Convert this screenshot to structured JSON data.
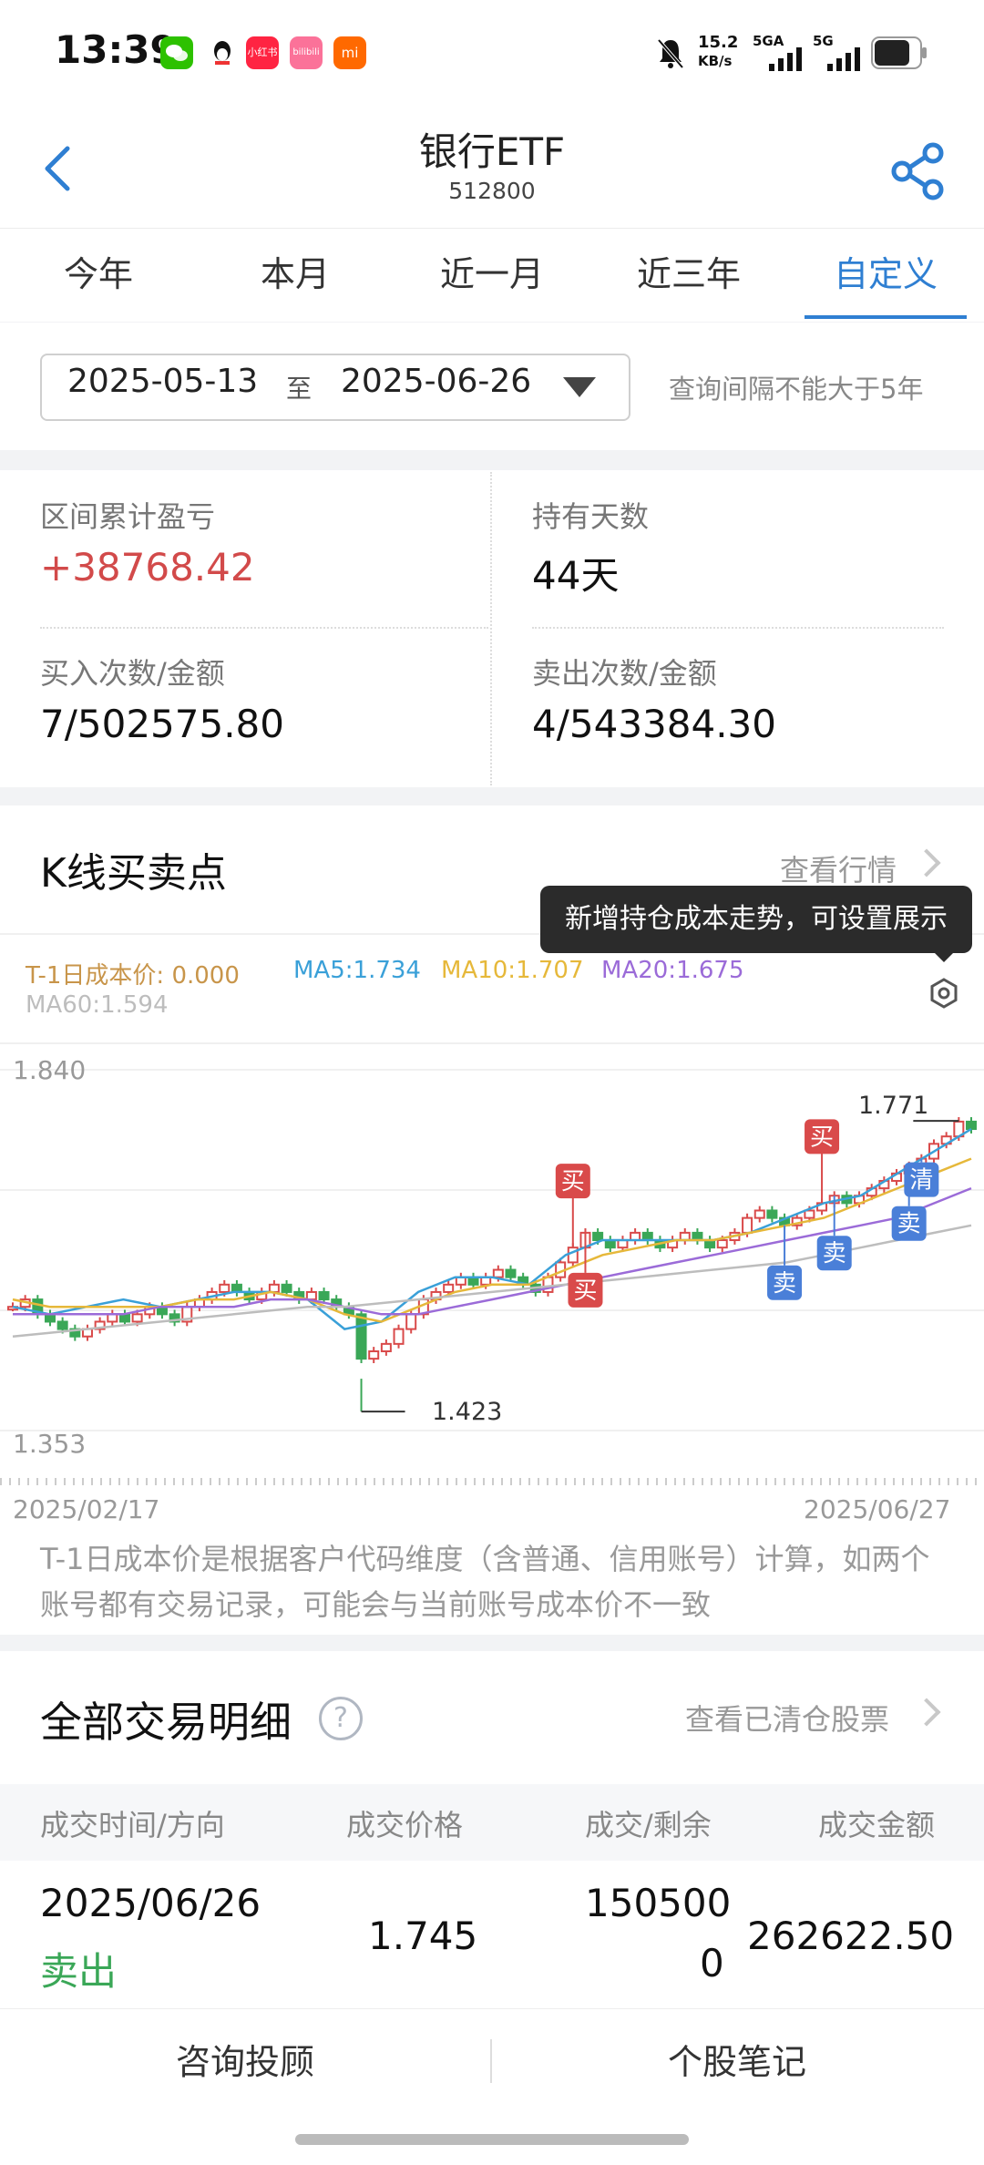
{
  "status_bar": {
    "time": "13:39",
    "apps": [
      {
        "name": "wechat-icon",
        "color": "#2dc100",
        "text": ""
      },
      {
        "name": "qq-icon",
        "color": "#ffffff",
        "text": ""
      },
      {
        "name": "xiaohongshu-icon",
        "color": "#ff2442",
        "text": "小红书"
      },
      {
        "name": "bilibili-icon",
        "color": "#fb7299",
        "text": "bilibili"
      },
      {
        "name": "mi-icon",
        "color": "#ff6900",
        "text": "mi"
      }
    ],
    "net_speed": "15.2",
    "net_unit": "KB/s",
    "sim1": "5GA",
    "sim2": "5G"
  },
  "header": {
    "title": "银行ETF",
    "code": "512800"
  },
  "tabs": [
    "今年",
    "本月",
    "近一月",
    "近三年",
    "自定义"
  ],
  "active_tab": 4,
  "date_range": {
    "start": "2025-05-13",
    "to": "至",
    "end": "2025-06-26",
    "note": "查询间隔不能大于5年"
  },
  "summary": {
    "pnl_label": "区间累计盈亏",
    "pnl_value": "+38768.42",
    "days_label": "持有天数",
    "days_value": "44天",
    "buy_label": "买入次数/金额",
    "buy_value": "7/502575.80",
    "sell_label": "卖出次数/金额",
    "sell_value": "4/543384.30"
  },
  "kline": {
    "title": "K线买卖点",
    "link": "查看行情",
    "tooltip": "新增持仓成本走势，可设置展示",
    "legend": {
      "cost": "T-1日成本价: 0.000",
      "ma5": "MA5:1.734",
      "ma10": "MA10:1.707",
      "ma20": "MA20:1.675",
      "ma60": "MA60:1.594"
    },
    "colors": {
      "cost": "#c8954a",
      "ma5": "#3aa0d8",
      "ma10": "#e6b83a",
      "ma20": "#9b6bd8",
      "ma60": "#bdbdbd",
      "up": "#d94a4a",
      "down": "#3aa757",
      "buy": "#d94a4a",
      "sell": "#4a7fd8"
    },
    "y_top_label": "1.840",
    "y_bottom_label": "1.353",
    "x_start_label": "2025/02/17",
    "x_end_label": "2025/06/27",
    "max_label": "1.771",
    "min_label": "1.423",
    "buy_tag": "买",
    "sell_tag": "卖",
    "clear_tag": "清",
    "disclaimer": "T-1日成本价是根据客户代码维度（含普通、信用账号）计算，如两个账号都有交易记录，可能会与当前账号成本价不一致"
  },
  "chart_data": {
    "type": "candlestick",
    "x_range": [
      "2025/02/17",
      "2025/06/27"
    ],
    "ylim": [
      1.353,
      1.84
    ],
    "max_price": 1.771,
    "min_price": 1.423,
    "closes": [
      1.52,
      1.53,
      1.51,
      1.5,
      1.49,
      1.48,
      1.49,
      1.5,
      1.51,
      1.5,
      1.51,
      1.52,
      1.51,
      1.5,
      1.52,
      1.53,
      1.54,
      1.55,
      1.54,
      1.53,
      1.54,
      1.55,
      1.54,
      1.53,
      1.54,
      1.53,
      1.52,
      1.51,
      1.45,
      1.46,
      1.47,
      1.49,
      1.51,
      1.53,
      1.54,
      1.55,
      1.56,
      1.55,
      1.56,
      1.57,
      1.56,
      1.55,
      1.54,
      1.56,
      1.58,
      1.6,
      1.62,
      1.61,
      1.6,
      1.61,
      1.62,
      1.61,
      1.6,
      1.61,
      1.62,
      1.61,
      1.6,
      1.61,
      1.62,
      1.64,
      1.65,
      1.64,
      1.63,
      1.64,
      1.65,
      1.66,
      1.67,
      1.66,
      1.67,
      1.68,
      1.69,
      1.7,
      1.71,
      1.72,
      1.74,
      1.75,
      1.77,
      1.76
    ],
    "series": [
      {
        "name": "MA5",
        "values": [
          1.52,
          1.51,
          1.52,
          1.53,
          1.52,
          1.53,
          1.54,
          1.54,
          1.53,
          1.49,
          1.5,
          1.54,
          1.56,
          1.56,
          1.55,
          1.59,
          1.61,
          1.61,
          1.61,
          1.61,
          1.62,
          1.64,
          1.66,
          1.67,
          1.7,
          1.73,
          1.76
        ]
      },
      {
        "name": "MA10",
        "values": [
          1.53,
          1.52,
          1.52,
          1.52,
          1.52,
          1.53,
          1.53,
          1.54,
          1.53,
          1.51,
          1.5,
          1.52,
          1.54,
          1.55,
          1.55,
          1.57,
          1.59,
          1.6,
          1.61,
          1.61,
          1.62,
          1.63,
          1.64,
          1.66,
          1.68,
          1.7,
          1.72
        ]
      },
      {
        "name": "MA20",
        "values": [
          1.51,
          1.51,
          1.51,
          1.51,
          1.52,
          1.52,
          1.52,
          1.53,
          1.53,
          1.52,
          1.51,
          1.51,
          1.52,
          1.53,
          1.54,
          1.55,
          1.56,
          1.57,
          1.58,
          1.59,
          1.6,
          1.61,
          1.62,
          1.63,
          1.64,
          1.66,
          1.68
        ]
      },
      {
        "name": "MA60",
        "values": [
          1.48,
          1.485,
          1.49,
          1.495,
          1.5,
          1.505,
          1.51,
          1.515,
          1.52,
          1.52,
          1.525,
          1.53,
          1.535,
          1.54,
          1.545,
          1.55,
          1.555,
          1.56,
          1.565,
          1.57,
          1.575,
          1.58,
          1.59,
          1.6,
          1.61,
          1.62,
          1.63
        ]
      }
    ],
    "markers": [
      {
        "type": "买",
        "index": 45
      },
      {
        "type": "买",
        "index": 46
      },
      {
        "type": "卖",
        "index": 62
      },
      {
        "type": "买",
        "index": 65
      },
      {
        "type": "卖",
        "index": 66
      },
      {
        "type": "卖",
        "index": 72
      },
      {
        "type": "清",
        "index": 73
      }
    ]
  },
  "trades": {
    "title": "全部交易明细",
    "link": "查看已清仓股票",
    "headers": [
      "成交时间/方向",
      "成交价格",
      "成交/剩余",
      "成交金额"
    ],
    "rows": [
      {
        "date": "2025/06/26",
        "direction": "卖出",
        "price": "1.745",
        "qty": "150500",
        "remain": "0",
        "amount": "262622.50"
      }
    ]
  },
  "bottom_bar": {
    "left": "咨询投顾",
    "right": "个股笔记"
  }
}
